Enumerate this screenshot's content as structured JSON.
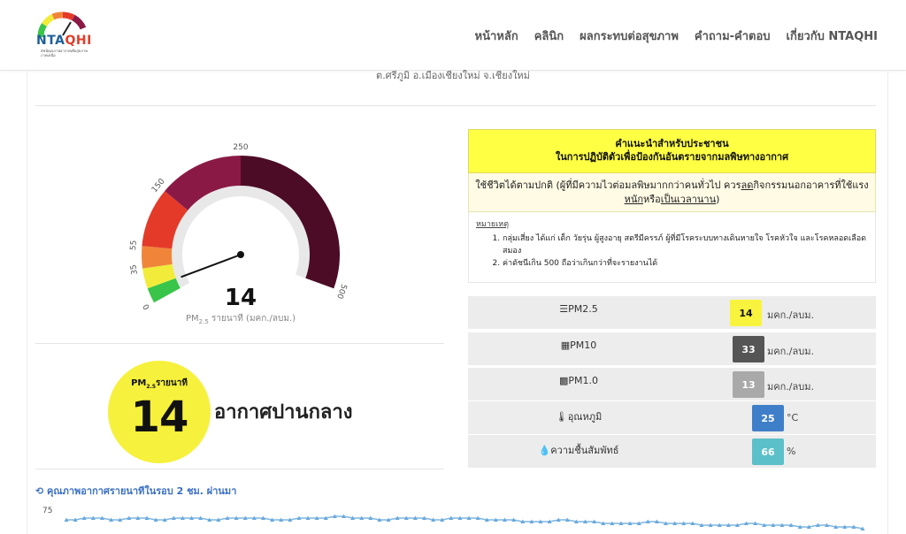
{
  "header": {
    "logo_text_a": "NTA",
    "logo_text_b": "QHI",
    "logo_sub": "ดัชนีคุณภาพอากาศเพื่อสุขภาพภาคเหนือ",
    "nav": [
      "หน้าหลัก",
      "คลินิก",
      "ผลกระทบต่อสุขภาพ",
      "คำถาม-คำตอบ",
      "เกี่ยวกับ NTAQHI"
    ]
  },
  "location": "ต.ศรีภูมิ อ.เมืองเชียงใหม่ จ.เชียงใหม่",
  "gauge": {
    "value": "14",
    "caption_pm": "PM",
    "caption_sub": "2.5",
    "caption_rest": " รายนาที (มคก./ลบม.)",
    "ticks": [
      "0",
      "35",
      "55",
      "150",
      "250",
      "500"
    ],
    "bands": [
      {
        "from": 0,
        "to": 15,
        "color": "#39c44a"
      },
      {
        "from": 15,
        "to": 35,
        "color": "#f1ec3a"
      },
      {
        "from": 35,
        "to": 55,
        "color": "#f0853a"
      },
      {
        "from": 55,
        "to": 150,
        "color": "#e43a2a"
      },
      {
        "from": 150,
        "to": 250,
        "color": "#8a1a45"
      },
      {
        "from": 250,
        "to": 500,
        "color": "#4c0c25"
      }
    ],
    "needle": 14
  },
  "aqi_circle": {
    "label_pm": "PM",
    "label_sub": "2.5",
    "label_rest": "รายนาที",
    "value": "14",
    "condition": "อากาศปานกลาง",
    "color": "#f6f13c"
  },
  "advice": {
    "title_line1": "คำแนะนำสำหรับประชาชน",
    "title_line2": "ในการปฏิบัติตัวเพื่อป้องกันอันตรายจากมลพิษทางอากาศ",
    "body_a": "ใช้ชีวิตได้ตามปกติ (ผู้ที่มีความไวต่อมลพิษมากกว่าคนทั่วไป ควร",
    "body_u1": "ลด",
    "body_b": "กิจกรรมนอกอาคารที่ใช้แรง",
    "body_u2": "หนัก",
    "body_c": "หรือ",
    "body_u3": "เป็นเวลานาน",
    "body_d": ")",
    "notes_title": "หมายเหตุ",
    "notes": [
      "กลุ่มเสี่ยง ได้แก่ เด็ก วัยรุ่น ผู้สูงอายุ สตรีมีครรภ์ ผู้ที่มีโรคระบบทางเดินหายใจ โรคหัวใจ และโรคหลอดเลือดสมอง",
      "ค่าดัชนีเกิน 500 ถือว่าเกินกว่าที่จะรายงานได้"
    ]
  },
  "readings": [
    {
      "label": "PM2.5",
      "icon": "bars-icon",
      "value": "14",
      "unit": "มคก./ลบม.",
      "bg": "#f8f43e",
      "fg": "#111"
    },
    {
      "label": "PM10",
      "icon": "grid-icon",
      "value": "33",
      "unit": "มคก./ลบม.",
      "bg": "#555555",
      "fg": "#fff"
    },
    {
      "label": "PM1.0",
      "icon": "squares-icon",
      "value": "13",
      "unit": "มคก./ลบม.",
      "bg": "#a9a9a9",
      "fg": "#fff"
    },
    {
      "label": "อุณหภูมิ",
      "icon": "thermometer-icon",
      "value": "25",
      "unit": "°C",
      "bg": "#3f7fc9",
      "fg": "#fff"
    },
    {
      "label": "ความชื้นสัมพัทธ์",
      "icon": "drop-icon",
      "value": "66",
      "unit": "%",
      "bg": "#5bc0c9",
      "fg": "#fff"
    }
  ],
  "chart_data": {
    "type": "line",
    "title": "คุณภาพอากาศรายนาทีในรอบ 2 ชม. ผ่านมา",
    "yticks": [
      "75"
    ],
    "series": [
      {
        "values": [
          78,
          78,
          79,
          79,
          79,
          78,
          78,
          79,
          79,
          79,
          78,
          78,
          79,
          79,
          79,
          79,
          78,
          78,
          79,
          79,
          79,
          79,
          79,
          78,
          78,
          78,
          79,
          79,
          79,
          79,
          80,
          80,
          79,
          79,
          79,
          78,
          78,
          79,
          79,
          79,
          79,
          78,
          78,
          79,
          79,
          79,
          79,
          78,
          78,
          78,
          78,
          77,
          77,
          77,
          77,
          78,
          78,
          77,
          77,
          77,
          76,
          76,
          76,
          76,
          76,
          77,
          77,
          76,
          76,
          76,
          76,
          75,
          75,
          75,
          75,
          75,
          76,
          76,
          75,
          75,
          75,
          75,
          74,
          74,
          75,
          75,
          74,
          74,
          74,
          73
        ]
      }
    ],
    "ylim": [
      0,
      80
    ]
  }
}
